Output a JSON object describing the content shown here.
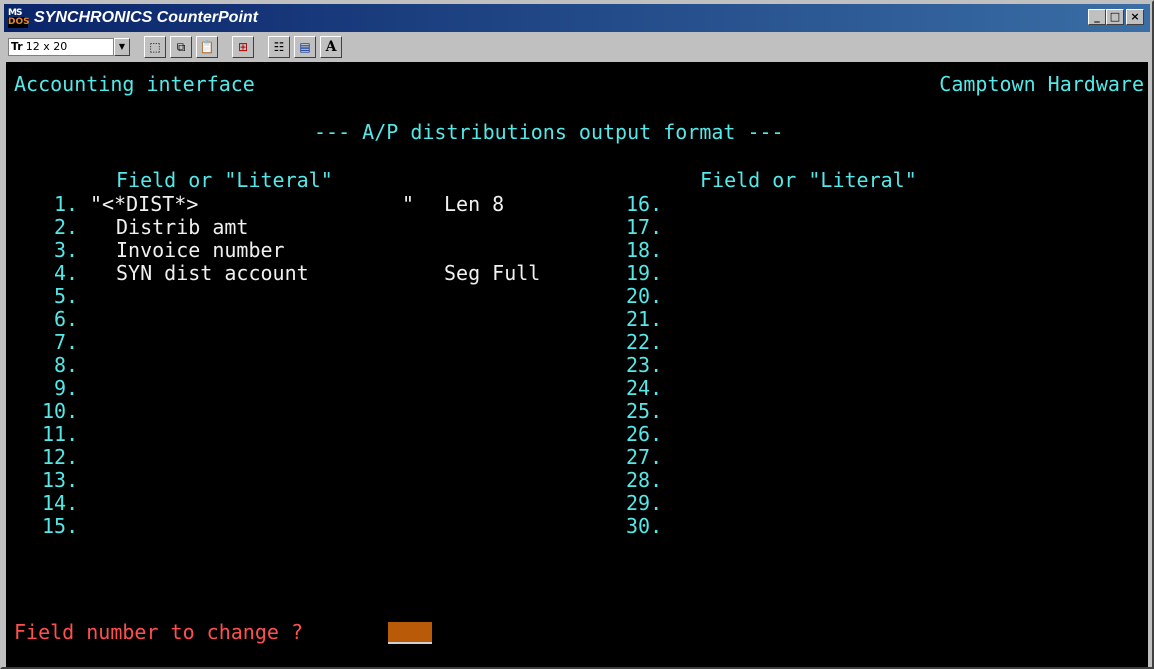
{
  "titlebar": {
    "title": "SYNCHRONICS CounterPoint",
    "icon_label_top": "MS",
    "icon_label_bottom": "DOS",
    "minimize_label": "_",
    "maximize_label": "□",
    "close_label": "×"
  },
  "toolbar": {
    "font_size_value": "12 x 20",
    "font_icon_label": "Tr",
    "buttons": [
      "mark-icon",
      "copy-icon",
      "paste-icon",
      "fullscreen-icon",
      "properties-icon",
      "background-icon",
      "font-icon"
    ],
    "font_button_label": "A"
  },
  "screen": {
    "header_left": "Accounting interface",
    "header_right": "Camptown Hardware",
    "title": "--- A/P distributions output format ---",
    "col_header_left": "Field or \"Literal\"",
    "col_header_right": "Field or \"Literal\"",
    "left_numbers": [
      "1.",
      "2.",
      "3.",
      "4.",
      "5.",
      "6.",
      "7.",
      "8.",
      "9.",
      "10.",
      "11.",
      "12.",
      "13.",
      "14.",
      "15."
    ],
    "right_numbers": [
      "16.",
      "17.",
      "18.",
      "19.",
      "20.",
      "21.",
      "22.",
      "23.",
      "24.",
      "25.",
      "26.",
      "27.",
      "28.",
      "29.",
      "30."
    ],
    "fields": [
      {
        "value": "\"<*DIST*>",
        "closing_quote": "\"",
        "option": "Len 8"
      },
      {
        "value": "Distrib amt",
        "option": ""
      },
      {
        "value": "Invoice number",
        "option": ""
      },
      {
        "value": "SYN dist account",
        "option": "Seg Full"
      }
    ],
    "prompt": "Field number to change ?"
  },
  "colors": {
    "terminal_bg": "#000000",
    "cyan_text": "#55e8e8",
    "white_text": "#f0f0f0",
    "prompt_red": "#ff5050",
    "cursor": "#b85a08",
    "title_gradient_start": "#0a246a",
    "title_gradient_end": "#3a6ea5"
  }
}
